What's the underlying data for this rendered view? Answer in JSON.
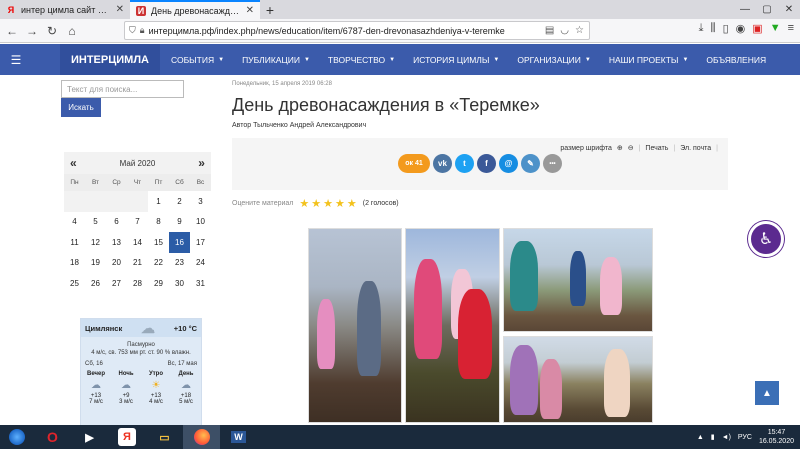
{
  "browser": {
    "tabs": [
      {
        "title": "интер цимла сайт — Яндекс: нашлос",
        "favicon": "Я",
        "active": false
      },
      {
        "title": "День древонасаждения в «Теремке»",
        "favicon": "И",
        "active": true
      }
    ],
    "url": "интерцимла.рф/index.php/news/education/item/6787-den-drevonasazhdeniya-v-teremke",
    "new_tab": "+",
    "window_controls": [
      "—",
      "▢",
      "✕"
    ]
  },
  "site": {
    "brand": "ИНТЕРЦИМЛА",
    "menu": [
      {
        "label": "СОБЫТИЯ",
        "caret": true
      },
      {
        "label": "ПУБЛИКАЦИИ",
        "caret": true
      },
      {
        "label": "ТВОРЧЕСТВО",
        "caret": true
      },
      {
        "label": "ИСТОРИЯ ЦИМЛЫ",
        "caret": true
      },
      {
        "label": "ОРГАНИЗАЦИИ",
        "caret": true
      },
      {
        "label": "НАШИ ПРОЕКТЫ",
        "caret": true
      },
      {
        "label": "ОБЪЯВЛЕНИЯ",
        "caret": false
      }
    ]
  },
  "sidebar": {
    "search_placeholder": "Текст для поиска...",
    "search_button": "Искать",
    "calendar": {
      "month": "Май 2020",
      "prev": "«",
      "next": "»",
      "weekdays": [
        "Пн",
        "Вт",
        "Ср",
        "Чт",
        "Пт",
        "Сб",
        "Вс"
      ],
      "days": [
        "",
        "",
        "",
        "",
        "1",
        "2",
        "3",
        "4",
        "5",
        "6",
        "7",
        "8",
        "9",
        "10",
        "11",
        "12",
        "13",
        "14",
        "15",
        "16",
        "17",
        "18",
        "19",
        "20",
        "21",
        "22",
        "23",
        "24",
        "25",
        "26",
        "27",
        "28",
        "29",
        "30",
        "31"
      ],
      "today": "16"
    },
    "weather": {
      "city": "Цимлянск",
      "temp": "+10 °С",
      "condition": "Пасмурно",
      "details": "4 м/с, св.  753 мм рт. ст.  90 % влажн.",
      "day1": "Сб, 16",
      "day2": "Вс, 17 мая",
      "periods": [
        {
          "label": "Вечер",
          "icon": "☁",
          "temp": "+13",
          "wind": "7 м/с"
        },
        {
          "label": "Ночь",
          "icon": "☁",
          "temp": "+9",
          "wind": "3 м/с"
        },
        {
          "label": "Утро",
          "icon": "☀",
          "temp": "+13",
          "wind": "4 м/с"
        },
        {
          "label": "День",
          "icon": "☁",
          "temp": "+18",
          "wind": "5 м/с"
        }
      ]
    }
  },
  "article": {
    "date": "Понедельник, 15 апреля 2019 06:28",
    "title": "День древонасаждения в «Теремке»",
    "author_label": "Автор",
    "author": "Тыльченко Андрей Александрович",
    "font_size_label": "размер шрифта",
    "print_label": "Печать",
    "email_label": "Эл. почта",
    "rate_label": "Оцените материал",
    "votes": "(2 голосов)",
    "rating": 5,
    "ok_count": "41",
    "social": [
      {
        "name": "ok-icon",
        "glyph": "ок",
        "color": "#f39a1d"
      },
      {
        "name": "vk-icon",
        "glyph": "vk",
        "color": "#4c75a3"
      },
      {
        "name": "twitter-icon",
        "glyph": "t",
        "color": "#1da1f2"
      },
      {
        "name": "facebook-icon",
        "glyph": "f",
        "color": "#3b5998"
      },
      {
        "name": "mail-icon",
        "glyph": "@",
        "color": "#168de2"
      },
      {
        "name": "livejournal-icon",
        "glyph": "✎",
        "color": "#4d92c9"
      },
      {
        "name": "more-icon",
        "glyph": "•••",
        "color": "#999999"
      }
    ]
  },
  "taskbar": {
    "lang": "РУС",
    "time": "15:47",
    "date": "16.05.2020"
  }
}
